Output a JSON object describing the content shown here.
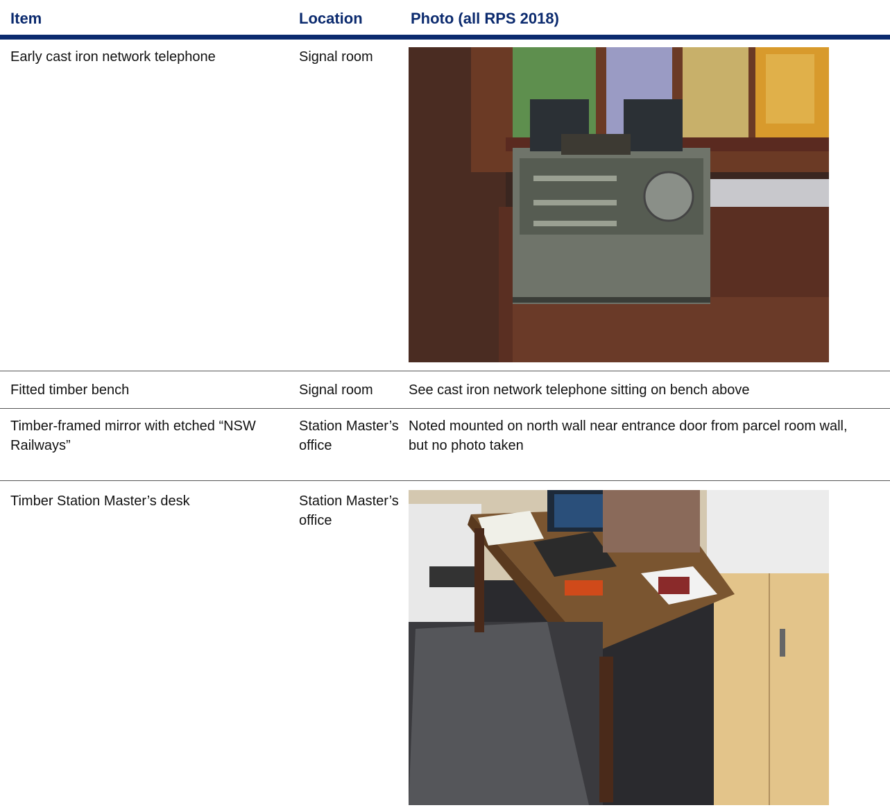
{
  "table": {
    "headers": {
      "item": "Item",
      "location": "Location",
      "photo": "Photo (all RPS 2018)"
    },
    "rows": [
      {
        "item": "Early cast iron network telephone",
        "location": "Signal room",
        "photo_desc": ""
      },
      {
        "item": "Fitted timber bench",
        "location": "Signal room",
        "photo_desc": "See cast iron network telephone sitting on bench above"
      },
      {
        "item": "Timber-framed mirror with etched “NSW Railways”",
        "location": "Station Master’s office",
        "photo_desc": "Noted mounted on north wall near entrance door from parcel room wall, but no photo taken"
      },
      {
        "item": "Timber Station Master’s desk",
        "location": "Station Master’s office",
        "photo_desc": ""
      }
    ]
  }
}
